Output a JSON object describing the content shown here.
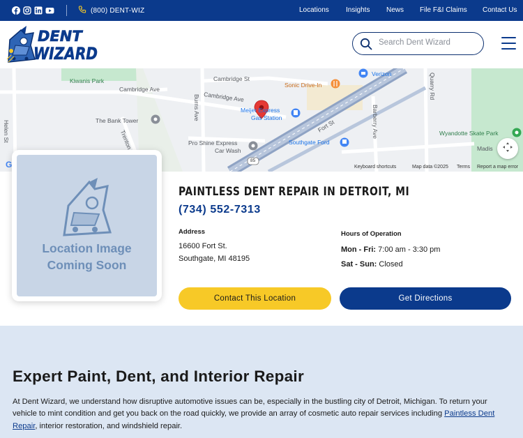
{
  "topbar": {
    "social": [
      "facebook-icon",
      "instagram-icon",
      "linkedin-icon",
      "youtube-icon"
    ],
    "phone": "(800) DENT-WIZ",
    "nav": [
      "Locations",
      "Insights",
      "News",
      "File F&I Claims",
      "Contact Us"
    ]
  },
  "header": {
    "logo_line1": "DENT",
    "logo_line2": "WIZARD",
    "search_placeholder": "Search Dent Wizard"
  },
  "map": {
    "labels": {
      "kiwanis": "Kiwanis Park",
      "cambridge1": "Cambridge Ave",
      "cambridge2": "Cambridge Ave",
      "cambridge_st": "Cambridge St",
      "sonic": "Sonic Drive-In",
      "verizon": "Verizon",
      "quarry": "Quarry Rd",
      "burns": "Burns Ave",
      "meijer1": "Meijer Express",
      "meijer2": "Gas Station",
      "bank": "The Bank Tower",
      "helen": "Helen St",
      "trenton": "Trenton",
      "fort": "Fort St",
      "barberry": "Barberry Ave",
      "wyandotte": "Wyandotte Skate Park",
      "madison": "Madis",
      "proshine1": "Pro Shine Express",
      "proshine2": "Car Wash",
      "southgate_ford": "Southgate Ford",
      "route": "85"
    },
    "footer": [
      "Keyboard shortcuts",
      "Map data ©2025",
      "Terms",
      "Report a map error"
    ]
  },
  "location": {
    "placeholder_line1": "Location Image",
    "placeholder_line2": "Coming Soon",
    "title": "PAINTLESS DENT REPAIR IN DETROIT, MI",
    "phone": "(734) 552-7313",
    "address_label": "Address",
    "address_line1": "16600 Fort St.",
    "address_line2": "Southgate, MI 48195",
    "hours_label": "Hours of Operation",
    "hours_weekday_label": "Mon - Fri:",
    "hours_weekday": "7:00 am - 3:30 pm",
    "hours_weekend_label": "Sat - Sun:",
    "hours_weekend": "Closed",
    "contact_button": "Contact This Location",
    "directions_button": "Get Directions"
  },
  "section": {
    "heading": "Expert Paint, Dent, and Interior Repair",
    "para_before": "At Dent Wizard, we understand how disruptive automotive issues can be, especially in the bustling city of Detroit, Michigan. To return your vehicle to mint condition and get you back on the road quickly, we provide an array of cosmetic auto repair services including ",
    "para_link": "Paintless Dent Repair",
    "para_after": ", interior restoration, and windshield repair."
  },
  "colors": {
    "brand_blue": "#0b3a8c",
    "accent_yellow": "#f7c927",
    "section_bg": "#dce6f3"
  }
}
